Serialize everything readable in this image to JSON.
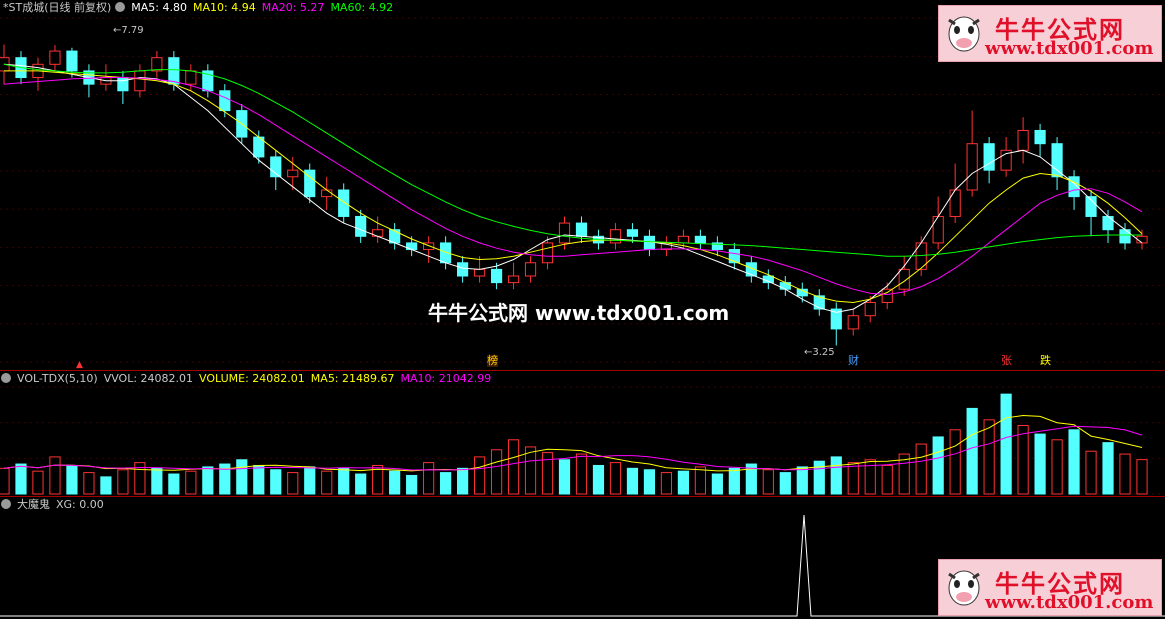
{
  "main_header": {
    "title": "*ST成城(日线 前复权)",
    "ma5": "MA5: 4.80",
    "ma10": "MA10: 4.94",
    "ma20": "MA20: 5.27",
    "ma60": "MA60: 4.92"
  },
  "vol_header": {
    "title": "VOL-TDX(5,10)",
    "vvol": "VVOL: 24082.01",
    "volume": "VOLUME: 24082.01",
    "ma5": "MA5: 21489.67",
    "ma10": "MA10: 21042.99"
  },
  "ind_header": {
    "title": "大魔鬼",
    "xg": "XG: 0.00"
  },
  "price_labels": {
    "high": "7.79",
    "low": "3.25"
  },
  "markers": {
    "bang": "榜",
    "cai": "财",
    "zhang": "张",
    "die": "跌"
  },
  "watermark": {
    "center": "牛牛公式网 www.tdx001.com",
    "logo_cn": "牛牛公式网",
    "logo_url": "www.tdx001.com"
  },
  "colors": {
    "up": "#ff3232",
    "down": "#54ffff",
    "ma5": "#ffffff",
    "ma10": "#ffff00",
    "ma20": "#ff00ff",
    "ma60": "#00ff00"
  },
  "chart_data": {
    "type": "candlestick",
    "ylim": [
      3.0,
      8.2
    ],
    "candles": [
      [
        7.4,
        7.6,
        7.8,
        7.2
      ],
      [
        7.6,
        7.3,
        7.7,
        7.2
      ],
      [
        7.3,
        7.5,
        7.6,
        7.1
      ],
      [
        7.5,
        7.7,
        7.79,
        7.4
      ],
      [
        7.7,
        7.4,
        7.75,
        7.3
      ],
      [
        7.4,
        7.2,
        7.5,
        7.0
      ],
      [
        7.2,
        7.3,
        7.5,
        7.1
      ],
      [
        7.3,
        7.1,
        7.4,
        6.9
      ],
      [
        7.1,
        7.4,
        7.5,
        7.0
      ],
      [
        7.4,
        7.6,
        7.7,
        7.3
      ],
      [
        7.6,
        7.2,
        7.7,
        7.1
      ],
      [
        7.2,
        7.4,
        7.5,
        7.1
      ],
      [
        7.4,
        7.1,
        7.5,
        7.0
      ],
      [
        7.1,
        6.8,
        7.2,
        6.7
      ],
      [
        6.8,
        6.4,
        6.9,
        6.3
      ],
      [
        6.4,
        6.1,
        6.5,
        6.0
      ],
      [
        6.1,
        5.8,
        6.2,
        5.6
      ],
      [
        5.8,
        5.9,
        6.1,
        5.6
      ],
      [
        5.9,
        5.5,
        6.0,
        5.4
      ],
      [
        5.5,
        5.6,
        5.8,
        5.3
      ],
      [
        5.6,
        5.2,
        5.7,
        5.1
      ],
      [
        5.2,
        4.9,
        5.3,
        4.8
      ],
      [
        4.9,
        5.0,
        5.2,
        4.8
      ],
      [
        5.0,
        4.8,
        5.1,
        4.7
      ],
      [
        4.8,
        4.7,
        4.9,
        4.6
      ],
      [
        4.7,
        4.8,
        4.9,
        4.5
      ],
      [
        4.8,
        4.5,
        4.9,
        4.4
      ],
      [
        4.5,
        4.3,
        4.6,
        4.2
      ],
      [
        4.3,
        4.4,
        4.6,
        4.2
      ],
      [
        4.4,
        4.2,
        4.5,
        4.1
      ],
      [
        4.2,
        4.3,
        4.5,
        4.1
      ],
      [
        4.3,
        4.5,
        4.6,
        4.2
      ],
      [
        4.5,
        4.8,
        4.9,
        4.4
      ],
      [
        4.8,
        5.1,
        5.2,
        4.7
      ],
      [
        5.1,
        4.9,
        5.2,
        4.8
      ],
      [
        4.9,
        4.8,
        5.0,
        4.7
      ],
      [
        4.8,
        5.0,
        5.1,
        4.7
      ],
      [
        5.0,
        4.9,
        5.1,
        4.8
      ],
      [
        4.9,
        4.7,
        5.0,
        4.6
      ],
      [
        4.7,
        4.8,
        4.9,
        4.6
      ],
      [
        4.8,
        4.9,
        5.0,
        4.7
      ],
      [
        4.9,
        4.8,
        5.0,
        4.7
      ],
      [
        4.8,
        4.7,
        4.9,
        4.6
      ],
      [
        4.7,
        4.5,
        4.8,
        4.4
      ],
      [
        4.5,
        4.3,
        4.6,
        4.2
      ],
      [
        4.3,
        4.2,
        4.4,
        4.1
      ],
      [
        4.2,
        4.1,
        4.3,
        4.0
      ],
      [
        4.1,
        4.0,
        4.2,
        3.9
      ],
      [
        4.0,
        3.8,
        4.1,
        3.7
      ],
      [
        3.8,
        3.5,
        3.9,
        3.25
      ],
      [
        3.5,
        3.7,
        3.8,
        3.4
      ],
      [
        3.7,
        3.9,
        4.0,
        3.6
      ],
      [
        3.9,
        4.1,
        4.2,
        3.8
      ],
      [
        4.1,
        4.4,
        4.6,
        4.0
      ],
      [
        4.4,
        4.8,
        4.9,
        4.3
      ],
      [
        4.8,
        5.2,
        5.5,
        4.7
      ],
      [
        5.2,
        5.6,
        6.0,
        5.1
      ],
      [
        5.6,
        6.3,
        6.8,
        5.5
      ],
      [
        6.3,
        5.9,
        6.4,
        5.7
      ],
      [
        5.9,
        6.2,
        6.4,
        5.8
      ],
      [
        6.2,
        6.5,
        6.7,
        6.0
      ],
      [
        6.5,
        6.3,
        6.6,
        6.1
      ],
      [
        6.3,
        5.8,
        6.4,
        5.6
      ],
      [
        5.8,
        5.5,
        5.9,
        5.3
      ],
      [
        5.5,
        5.2,
        5.6,
        4.9
      ],
      [
        5.2,
        5.0,
        5.3,
        4.8
      ],
      [
        5.0,
        4.8,
        5.1,
        4.7
      ],
      [
        4.8,
        4.9,
        5.0,
        4.7
      ]
    ],
    "volume_series": [
      [
        1,
        18000
      ],
      [
        0,
        21000
      ],
      [
        1,
        16000
      ],
      [
        1,
        26000
      ],
      [
        0,
        20000
      ],
      [
        1,
        15000
      ],
      [
        0,
        12000
      ],
      [
        1,
        17000
      ],
      [
        1,
        22000
      ],
      [
        0,
        18000
      ],
      [
        0,
        14000
      ],
      [
        1,
        16000
      ],
      [
        0,
        19000
      ],
      [
        0,
        21000
      ],
      [
        0,
        24000
      ],
      [
        0,
        20000
      ],
      [
        0,
        17000
      ],
      [
        1,
        15000
      ],
      [
        0,
        19000
      ],
      [
        1,
        16000
      ],
      [
        0,
        18000
      ],
      [
        0,
        14000
      ],
      [
        1,
        20000
      ],
      [
        0,
        16000
      ],
      [
        0,
        13000
      ],
      [
        1,
        22000
      ],
      [
        0,
        15000
      ],
      [
        0,
        18000
      ],
      [
        1,
        26000
      ],
      [
        1,
        31000
      ],
      [
        1,
        38000
      ],
      [
        1,
        33000
      ],
      [
        1,
        29000
      ],
      [
        0,
        24000
      ],
      [
        1,
        28000
      ],
      [
        0,
        20000
      ],
      [
        1,
        22000
      ],
      [
        0,
        18000
      ],
      [
        0,
        17000
      ],
      [
        1,
        15000
      ],
      [
        0,
        16000
      ],
      [
        1,
        19000
      ],
      [
        0,
        14000
      ],
      [
        0,
        18000
      ],
      [
        0,
        21000
      ],
      [
        1,
        17000
      ],
      [
        0,
        15000
      ],
      [
        0,
        19000
      ],
      [
        0,
        23000
      ],
      [
        0,
        26000
      ],
      [
        1,
        22000
      ],
      [
        1,
        24000
      ],
      [
        1,
        20000
      ],
      [
        1,
        28000
      ],
      [
        1,
        35000
      ],
      [
        0,
        40000
      ],
      [
        1,
        45000
      ],
      [
        0,
        60000
      ],
      [
        1,
        52000
      ],
      [
        0,
        70000
      ],
      [
        1,
        48000
      ],
      [
        0,
        42000
      ],
      [
        1,
        38000
      ],
      [
        0,
        45000
      ],
      [
        1,
        30000
      ],
      [
        0,
        36000
      ],
      [
        1,
        28000
      ],
      [
        1,
        24082
      ]
    ],
    "ma_lines": {
      "ma5": [
        7.5,
        7.48,
        7.45,
        7.4,
        7.35,
        7.3,
        7.25,
        7.25,
        7.3,
        7.28,
        7.2,
        7.0,
        6.8,
        6.55,
        6.3,
        6.05,
        5.85,
        5.65,
        5.45,
        5.25,
        5.1,
        5.0,
        4.9,
        4.8,
        4.7,
        4.6,
        4.5,
        4.42,
        4.4,
        4.45,
        4.55,
        4.7,
        4.85,
        4.92,
        4.9,
        4.88,
        4.86,
        4.84,
        4.82,
        4.78,
        4.72,
        4.62,
        4.52,
        4.42,
        4.32,
        4.22,
        4.1,
        3.95,
        3.82,
        3.75,
        3.8,
        3.95,
        4.15,
        4.45,
        4.8,
        5.2,
        5.6,
        5.85,
        6.0,
        6.15,
        6.2,
        6.1,
        5.9,
        5.7,
        5.45,
        5.2,
        5.0,
        4.8
      ],
      "ma10": [
        7.4,
        7.4,
        7.4,
        7.38,
        7.36,
        7.34,
        7.32,
        7.3,
        7.28,
        7.25,
        7.2,
        7.1,
        6.95,
        6.78,
        6.6,
        6.4,
        6.2,
        6.0,
        5.8,
        5.6,
        5.42,
        5.25,
        5.1,
        4.98,
        4.86,
        4.76,
        4.66,
        4.58,
        4.55,
        4.56,
        4.6,
        4.66,
        4.72,
        4.78,
        4.82,
        4.84,
        4.84,
        4.83,
        4.82,
        4.8,
        4.76,
        4.7,
        4.62,
        4.52,
        4.42,
        4.32,
        4.2,
        4.08,
        3.98,
        3.92,
        3.9,
        3.95,
        4.05,
        4.22,
        4.42,
        4.65,
        4.9,
        5.15,
        5.4,
        5.6,
        5.78,
        5.85,
        5.82,
        5.72,
        5.58,
        5.4,
        5.18,
        4.94
      ],
      "ma20": [
        7.2,
        7.22,
        7.24,
        7.26,
        7.28,
        7.29,
        7.3,
        7.3,
        7.29,
        7.27,
        7.24,
        7.18,
        7.1,
        7.0,
        6.88,
        6.74,
        6.58,
        6.42,
        6.26,
        6.1,
        5.94,
        5.78,
        5.62,
        5.46,
        5.3,
        5.16,
        5.02,
        4.9,
        4.8,
        4.72,
        4.66,
        4.62,
        4.6,
        4.6,
        4.62,
        4.64,
        4.66,
        4.68,
        4.7,
        4.71,
        4.71,
        4.7,
        4.68,
        4.64,
        4.6,
        4.54,
        4.46,
        4.38,
        4.28,
        4.18,
        4.1,
        4.04,
        4.02,
        4.06,
        4.14,
        4.26,
        4.42,
        4.6,
        4.8,
        5.0,
        5.2,
        5.4,
        5.52,
        5.6,
        5.62,
        5.55,
        5.42,
        5.27
      ],
      "ma60": [
        7.5,
        7.45,
        7.42,
        7.4,
        7.38,
        7.37,
        7.37,
        7.38,
        7.4,
        7.42,
        7.42,
        7.4,
        7.35,
        7.28,
        7.18,
        7.06,
        6.92,
        6.78,
        6.62,
        6.46,
        6.3,
        6.14,
        5.98,
        5.83,
        5.68,
        5.55,
        5.42,
        5.3,
        5.2,
        5.12,
        5.05,
        4.99,
        4.94,
        4.9,
        4.87,
        4.85,
        4.84,
        4.83,
        4.82,
        4.81,
        4.8,
        4.79,
        4.78,
        4.77,
        4.76,
        4.74,
        4.72,
        4.7,
        4.68,
        4.66,
        4.64,
        4.62,
        4.6,
        4.6,
        4.61,
        4.63,
        4.66,
        4.7,
        4.74,
        4.78,
        4.82,
        4.85,
        4.88,
        4.9,
        4.91,
        4.92,
        4.92,
        4.92
      ]
    }
  }
}
